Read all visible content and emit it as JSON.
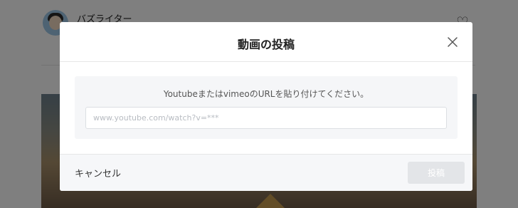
{
  "background": {
    "username": "バズライター",
    "heart_icon": "heart-outline-icon"
  },
  "modal": {
    "title": "動画の投稿",
    "close_icon": "close-icon",
    "instruction": "Youtubeまたはvimeo​のURLを貼り付けてください。",
    "url_input": {
      "value": "",
      "placeholder": "www.youtube.com/watch?v=***"
    },
    "cancel_label": "キャンセル",
    "submit_label": "投稿",
    "submit_disabled": true
  },
  "colors": {
    "overlay": "#000000",
    "panel_bg": "#f5f6f8",
    "disabled_button": "#e3e5e8"
  }
}
